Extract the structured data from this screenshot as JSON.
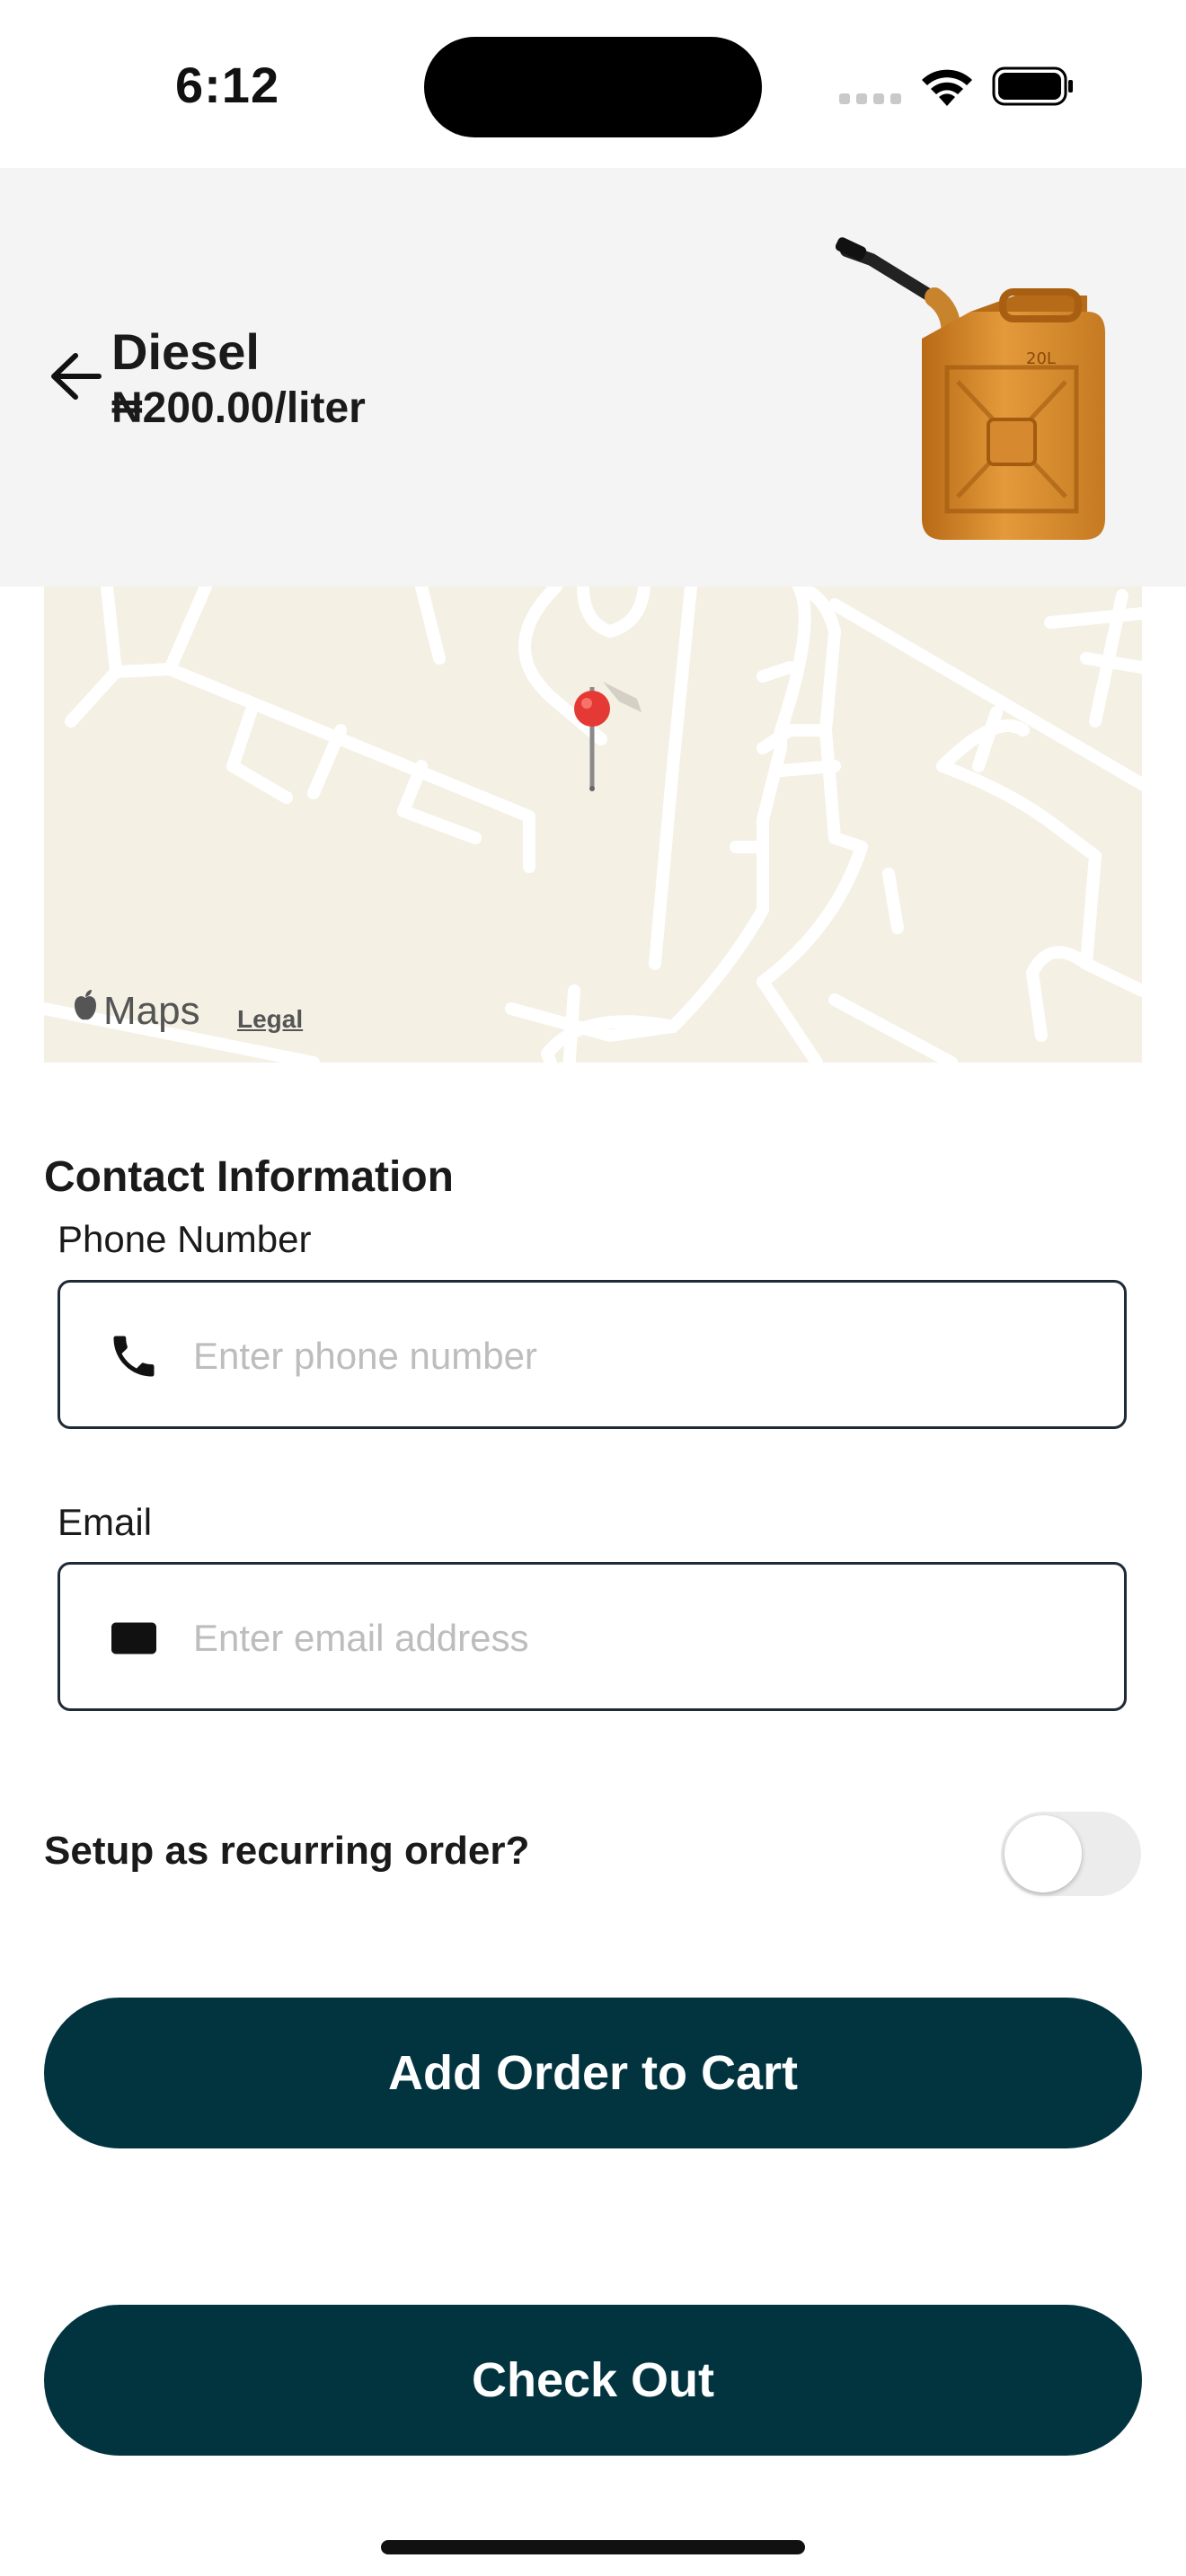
{
  "status_bar": {
    "time": "6:12"
  },
  "header": {
    "title": "Diesel",
    "price": "₦200.00/liter",
    "jerrycan_label": "20L"
  },
  "map": {
    "provider_label": "Maps",
    "legal_label": "Legal"
  },
  "contact": {
    "section_title": "Contact Information",
    "phone_label": "Phone Number",
    "phone_placeholder": "Enter phone number",
    "phone_value": "",
    "email_label": "Email",
    "email_placeholder": "Enter email address",
    "email_value": ""
  },
  "recurring": {
    "label": "Setup as recurring order?",
    "enabled": false
  },
  "buttons": {
    "add_to_cart": "Add Order to Cart",
    "checkout": "Check Out"
  },
  "colors": {
    "primary": "#023440",
    "header_bg": "#f4f4f4",
    "map_bg": "#f4f0e4",
    "pin": "#e53935"
  }
}
